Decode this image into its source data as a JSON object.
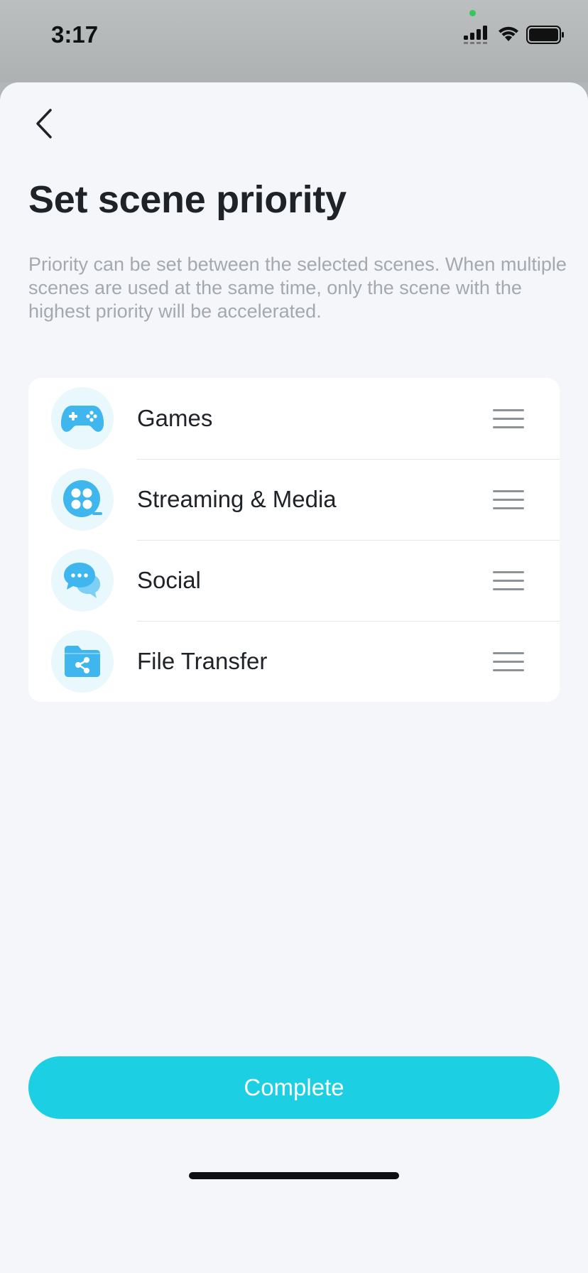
{
  "status_bar": {
    "time": "3:17",
    "icons": [
      "signal-icon",
      "wifi-icon",
      "battery-icon"
    ]
  },
  "header": {
    "back_icon": "chevron-left-icon",
    "title": "Set scene priority",
    "description": "Priority can be set between the selected scenes. When multiple scenes are used at the same time, only the scene with the highest priority will be accelerated."
  },
  "scenes": [
    {
      "label": "Games",
      "icon": "gamepad-icon"
    },
    {
      "label": "Streaming & Media",
      "icon": "film-reel-icon"
    },
    {
      "label": "Social",
      "icon": "chat-bubbles-icon"
    },
    {
      "label": "File Transfer",
      "icon": "folder-share-icon"
    }
  ],
  "footer": {
    "complete_label": "Complete"
  },
  "colors": {
    "accent": "#1ccfe3",
    "icon_blue": "#3fb6ee",
    "icon_bg": "#e8f8fc",
    "background": "#f4f6fa"
  }
}
